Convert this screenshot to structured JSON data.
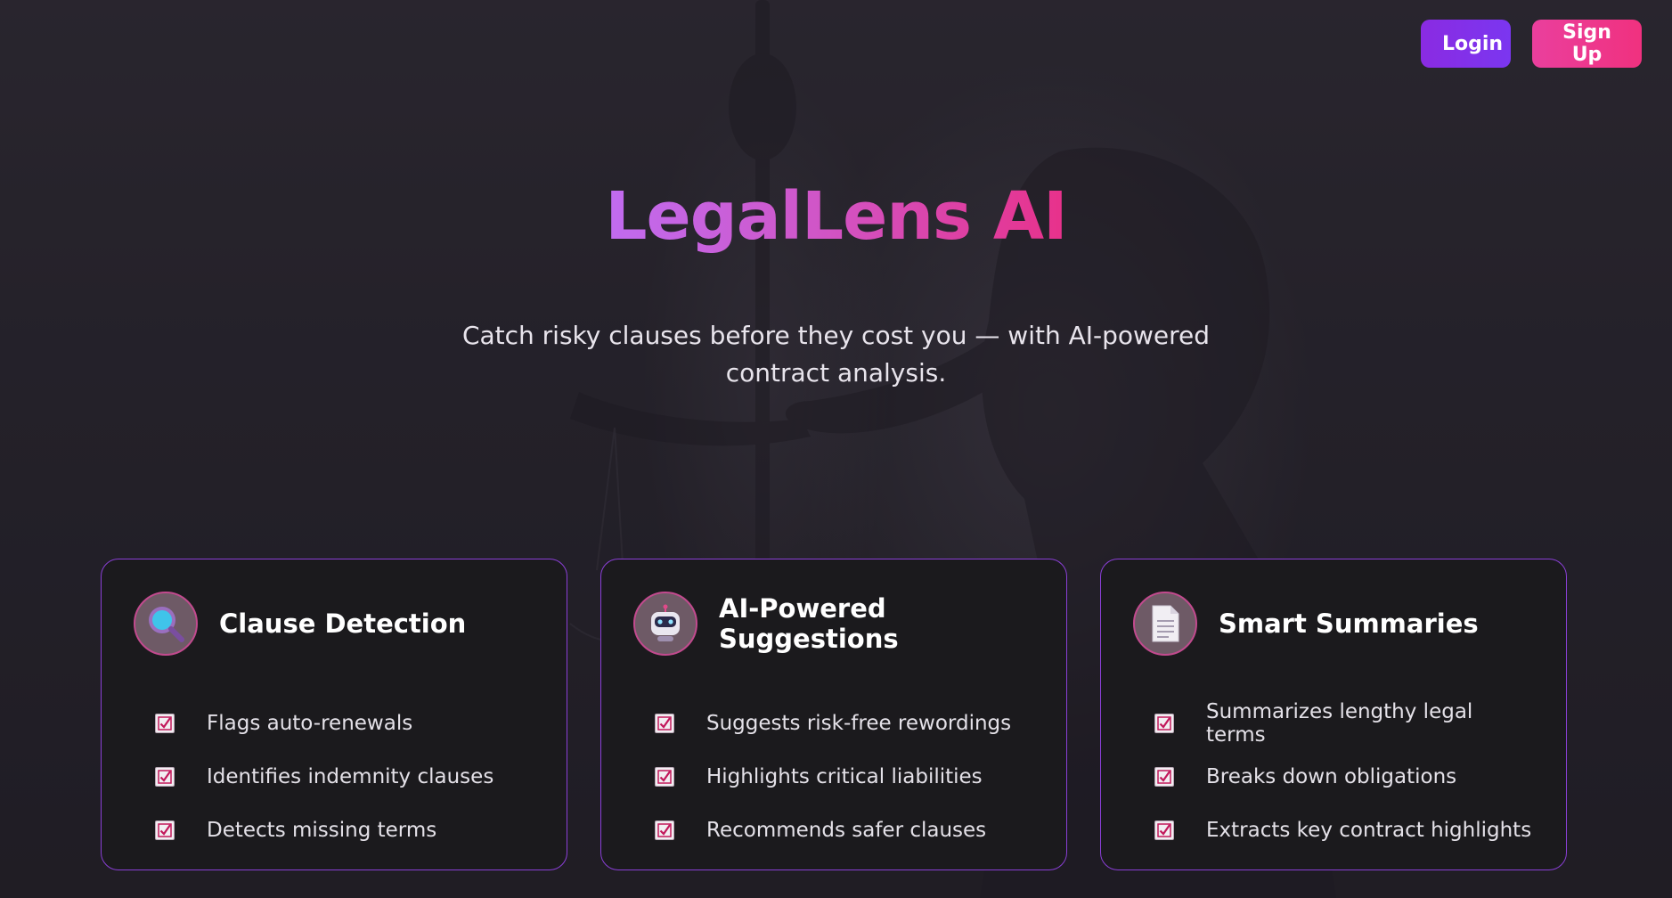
{
  "header": {
    "login_label": "Login",
    "signup_label": "Sign Up"
  },
  "hero": {
    "title": "LegalLens AI",
    "subtitle": "Catch risky clauses before they cost you — with AI-powered contract analysis."
  },
  "features": [
    {
      "icon": "magnifying-glass-icon",
      "title": "Clause Detection",
      "items": [
        "Flags auto-renewals",
        "Identifies indemnity clauses",
        "Detects missing terms"
      ]
    },
    {
      "icon": "robot-icon",
      "title": "AI-Powered Suggestions",
      "items": [
        "Suggests risk-free rewordings",
        "Highlights critical liabilities",
        "Recommends safer clauses"
      ]
    },
    {
      "icon": "document-icon",
      "title": "Smart Summaries",
      "items": [
        "Summarizes lengthy legal terms",
        "Breaks down obligations",
        "Extracts key contract highlights"
      ]
    }
  ],
  "colors": {
    "accent_purple": "#8a2be2",
    "accent_pink": "#f0317f",
    "card_background": "#1b1a1d",
    "card_border": "#8a3fd6"
  }
}
